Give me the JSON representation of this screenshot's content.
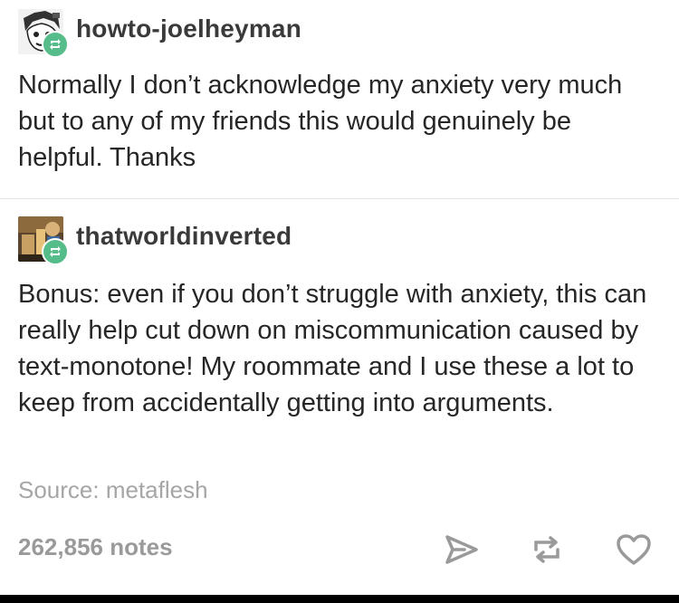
{
  "posts": [
    {
      "username": "howto-joelheyman",
      "avatar": "manga-face-avatar",
      "badge_icon": "reblog-icon",
      "text": "Normally I don’t acknowledge my anxiety very much but to any of my friends this would genuinely be helpful. Thanks"
    },
    {
      "username": "thatworldinverted",
      "avatar": "photo-avatar",
      "badge_icon": "reblog-icon",
      "text": "Bonus: even if you don’t struggle with anxiety, this can really help cut down on miscommunication caused by text-monotone! My roommate and I use these a lot to keep from accidentally getting into arguments."
    }
  ],
  "footer": {
    "source": "Source: metaflesh",
    "notes": "262,856 notes",
    "actions": [
      "share-icon",
      "reblog-icon",
      "heart-icon"
    ]
  },
  "colors": {
    "reblog_badge": "#56bc8a",
    "muted_text": "#a6a6a6",
    "icon": "#9a9a9a"
  }
}
